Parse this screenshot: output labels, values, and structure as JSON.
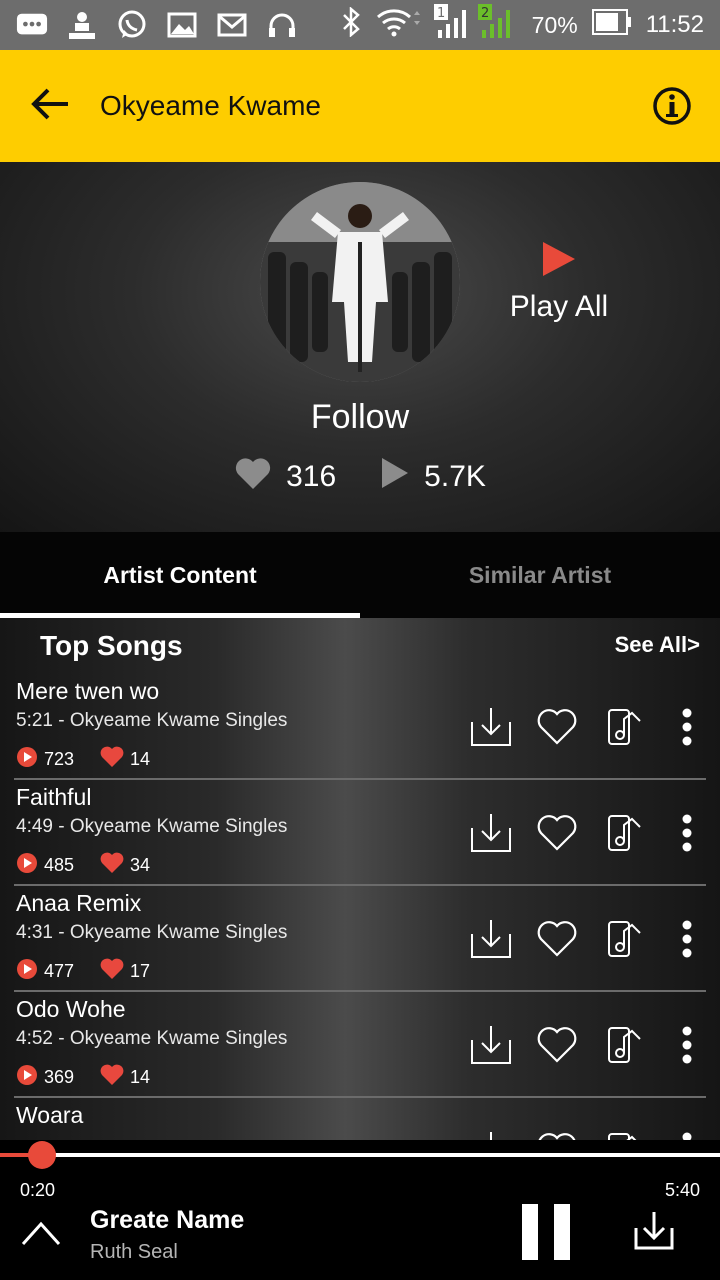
{
  "status_bar": {
    "battery": "70%",
    "time": "11:52",
    "sim1": "1",
    "sim2": "2",
    "icons": [
      "chat-icon",
      "dj-icon",
      "whatsapp-icon",
      "gallery-icon",
      "mail-icon",
      "headphones-icon",
      "bluetooth-icon",
      "wifi-icon",
      "signal-icon",
      "battery-icon"
    ]
  },
  "app_bar": {
    "title": "Okyeame Kwame",
    "back_icon": "arrow-left-icon",
    "info_icon": "info-icon",
    "color": "#fecd00"
  },
  "hero": {
    "play_all_label": "Play All",
    "follow_label": "Follow",
    "likes": "316",
    "plays": "5.7K",
    "accent": "#e84a3a"
  },
  "tabs": [
    {
      "label": "Artist Content",
      "active": true
    },
    {
      "label": "Similar Artist",
      "active": false
    }
  ],
  "section": {
    "title": "Top Songs",
    "see_all": "See All>"
  },
  "songs": [
    {
      "title": "Mere twen wo",
      "meta": "5:21 -  Okyeame Kwame Singles",
      "plays": "723",
      "likes": "14"
    },
    {
      "title": "Faithful",
      "meta": "4:49 -  Okyeame Kwame Singles",
      "plays": "485",
      "likes": "34"
    },
    {
      "title": "Anaa Remix",
      "meta": "4:31 -  Okyeame Kwame Singles",
      "plays": "477",
      "likes": "17"
    },
    {
      "title": "Odo Wohe",
      "meta": "4:52 -  Okyeame Kwame Singles",
      "plays": "369",
      "likes": "14"
    },
    {
      "title": "Woara",
      "meta": "",
      "plays": "",
      "likes": ""
    }
  ],
  "player": {
    "current_time": "0:20",
    "total_time": "5:40",
    "progress_fraction": 0.0588,
    "title": "Greate Name",
    "artist": "Ruth Seal"
  }
}
